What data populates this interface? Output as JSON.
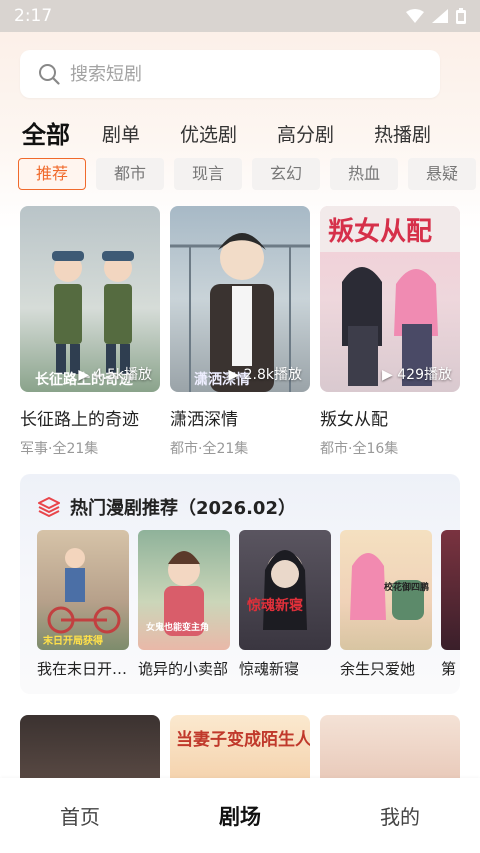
{
  "status_bar": {
    "time": "2:17"
  },
  "search": {
    "placeholder": "搜索短剧"
  },
  "category_tabs": [
    "全部",
    "剧单",
    "优选剧",
    "高分剧",
    "热播剧"
  ],
  "genres": [
    "推荐",
    "都市",
    "现言",
    "玄幻",
    "热血",
    "悬疑"
  ],
  "cards": [
    {
      "title": "长征路上的奇迹",
      "meta": "军事·全21集",
      "plays": "4.5k播放",
      "poster_text": "长征路上的奇迹"
    },
    {
      "title": "潇洒深情",
      "meta": "都市·全21集",
      "plays": "2.8k播放",
      "poster_text": "潇洒深情"
    },
    {
      "title": "叛女从配",
      "meta": "都市·全16集",
      "plays": "429播放",
      "poster_text": "叛女从配"
    }
  ],
  "hot": {
    "title": "热门漫剧推荐（2026.02）",
    "items": [
      {
        "title": "我在末日开…",
        "poster_text": "末日开局获得"
      },
      {
        "title": "诡异的小卖部",
        "poster_text": "女鬼也能变主角"
      },
      {
        "title": "惊魂新寝",
        "poster_text": "惊魂新寝"
      },
      {
        "title": "余生只爱她",
        "poster_text": "校花御四鹏"
      },
      {
        "title": "第"
      }
    ]
  },
  "bottom_posters": [
    {
      "poster_text": ""
    },
    {
      "poster_text": "当妻子变成陌生人"
    },
    {
      "poster_text": ""
    }
  ],
  "nav": [
    "首页",
    "剧场",
    "我的"
  ]
}
